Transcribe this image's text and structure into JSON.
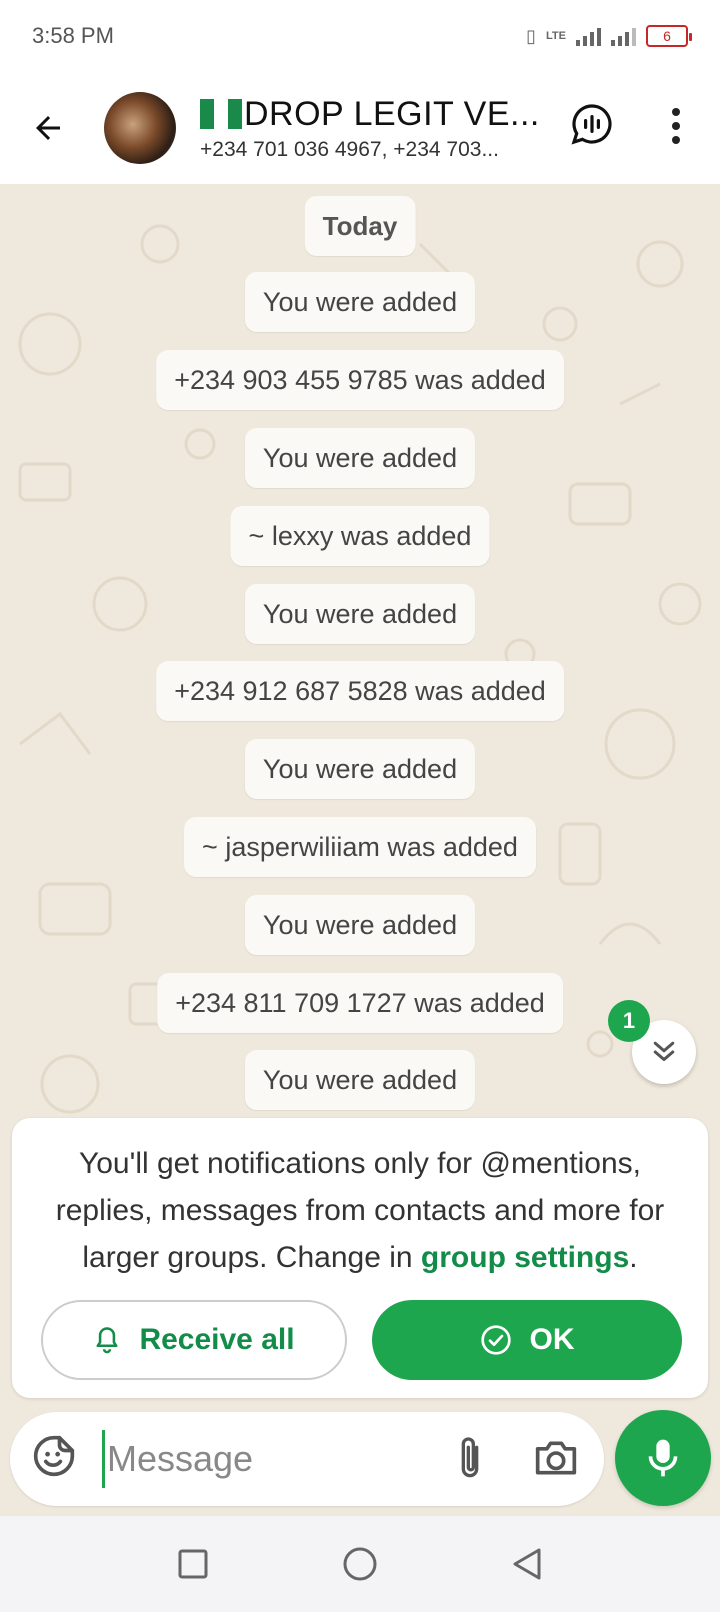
{
  "status_bar": {
    "time": "3:58 PM",
    "lte_label": "LTE",
    "battery_level": "6"
  },
  "header": {
    "group_name": "DROP LEGIT VE...",
    "participants": "+234 701 036 4967, +234 703..."
  },
  "chat": {
    "date_chip": "Today",
    "messages": [
      "You were added",
      "+234 903 455 9785 was added",
      "You were added",
      "~ lexxy was added",
      "You were added",
      "+234 912 687 5828 was added",
      "You were added",
      "~ jasperwiliiam was added",
      "You were added",
      "+234 811 709 1727 was added",
      "You were added"
    ],
    "unread_count": "1"
  },
  "notice": {
    "text_before": "You'll get notifications only for @mentions, replies, messages from contacts and more for larger groups. Change in ",
    "link": "group settings",
    "text_after": ".",
    "receive_all_label": "Receive all",
    "ok_label": "OK"
  },
  "composer": {
    "placeholder": "Message"
  },
  "colors": {
    "accent": "#1ea64f",
    "link": "#128c48",
    "chat_bg": "#efe8dc"
  },
  "icons": {
    "back": "arrow-left-icon",
    "call": "voice-chat-icon",
    "menu": "more-vertical-icon",
    "scroll_down": "double-chevron-down-icon",
    "bell": "bell-icon",
    "check": "check-circle-icon",
    "sticker": "sticker-icon",
    "attach": "paperclip-icon",
    "camera": "camera-icon",
    "mic": "microphone-icon"
  }
}
